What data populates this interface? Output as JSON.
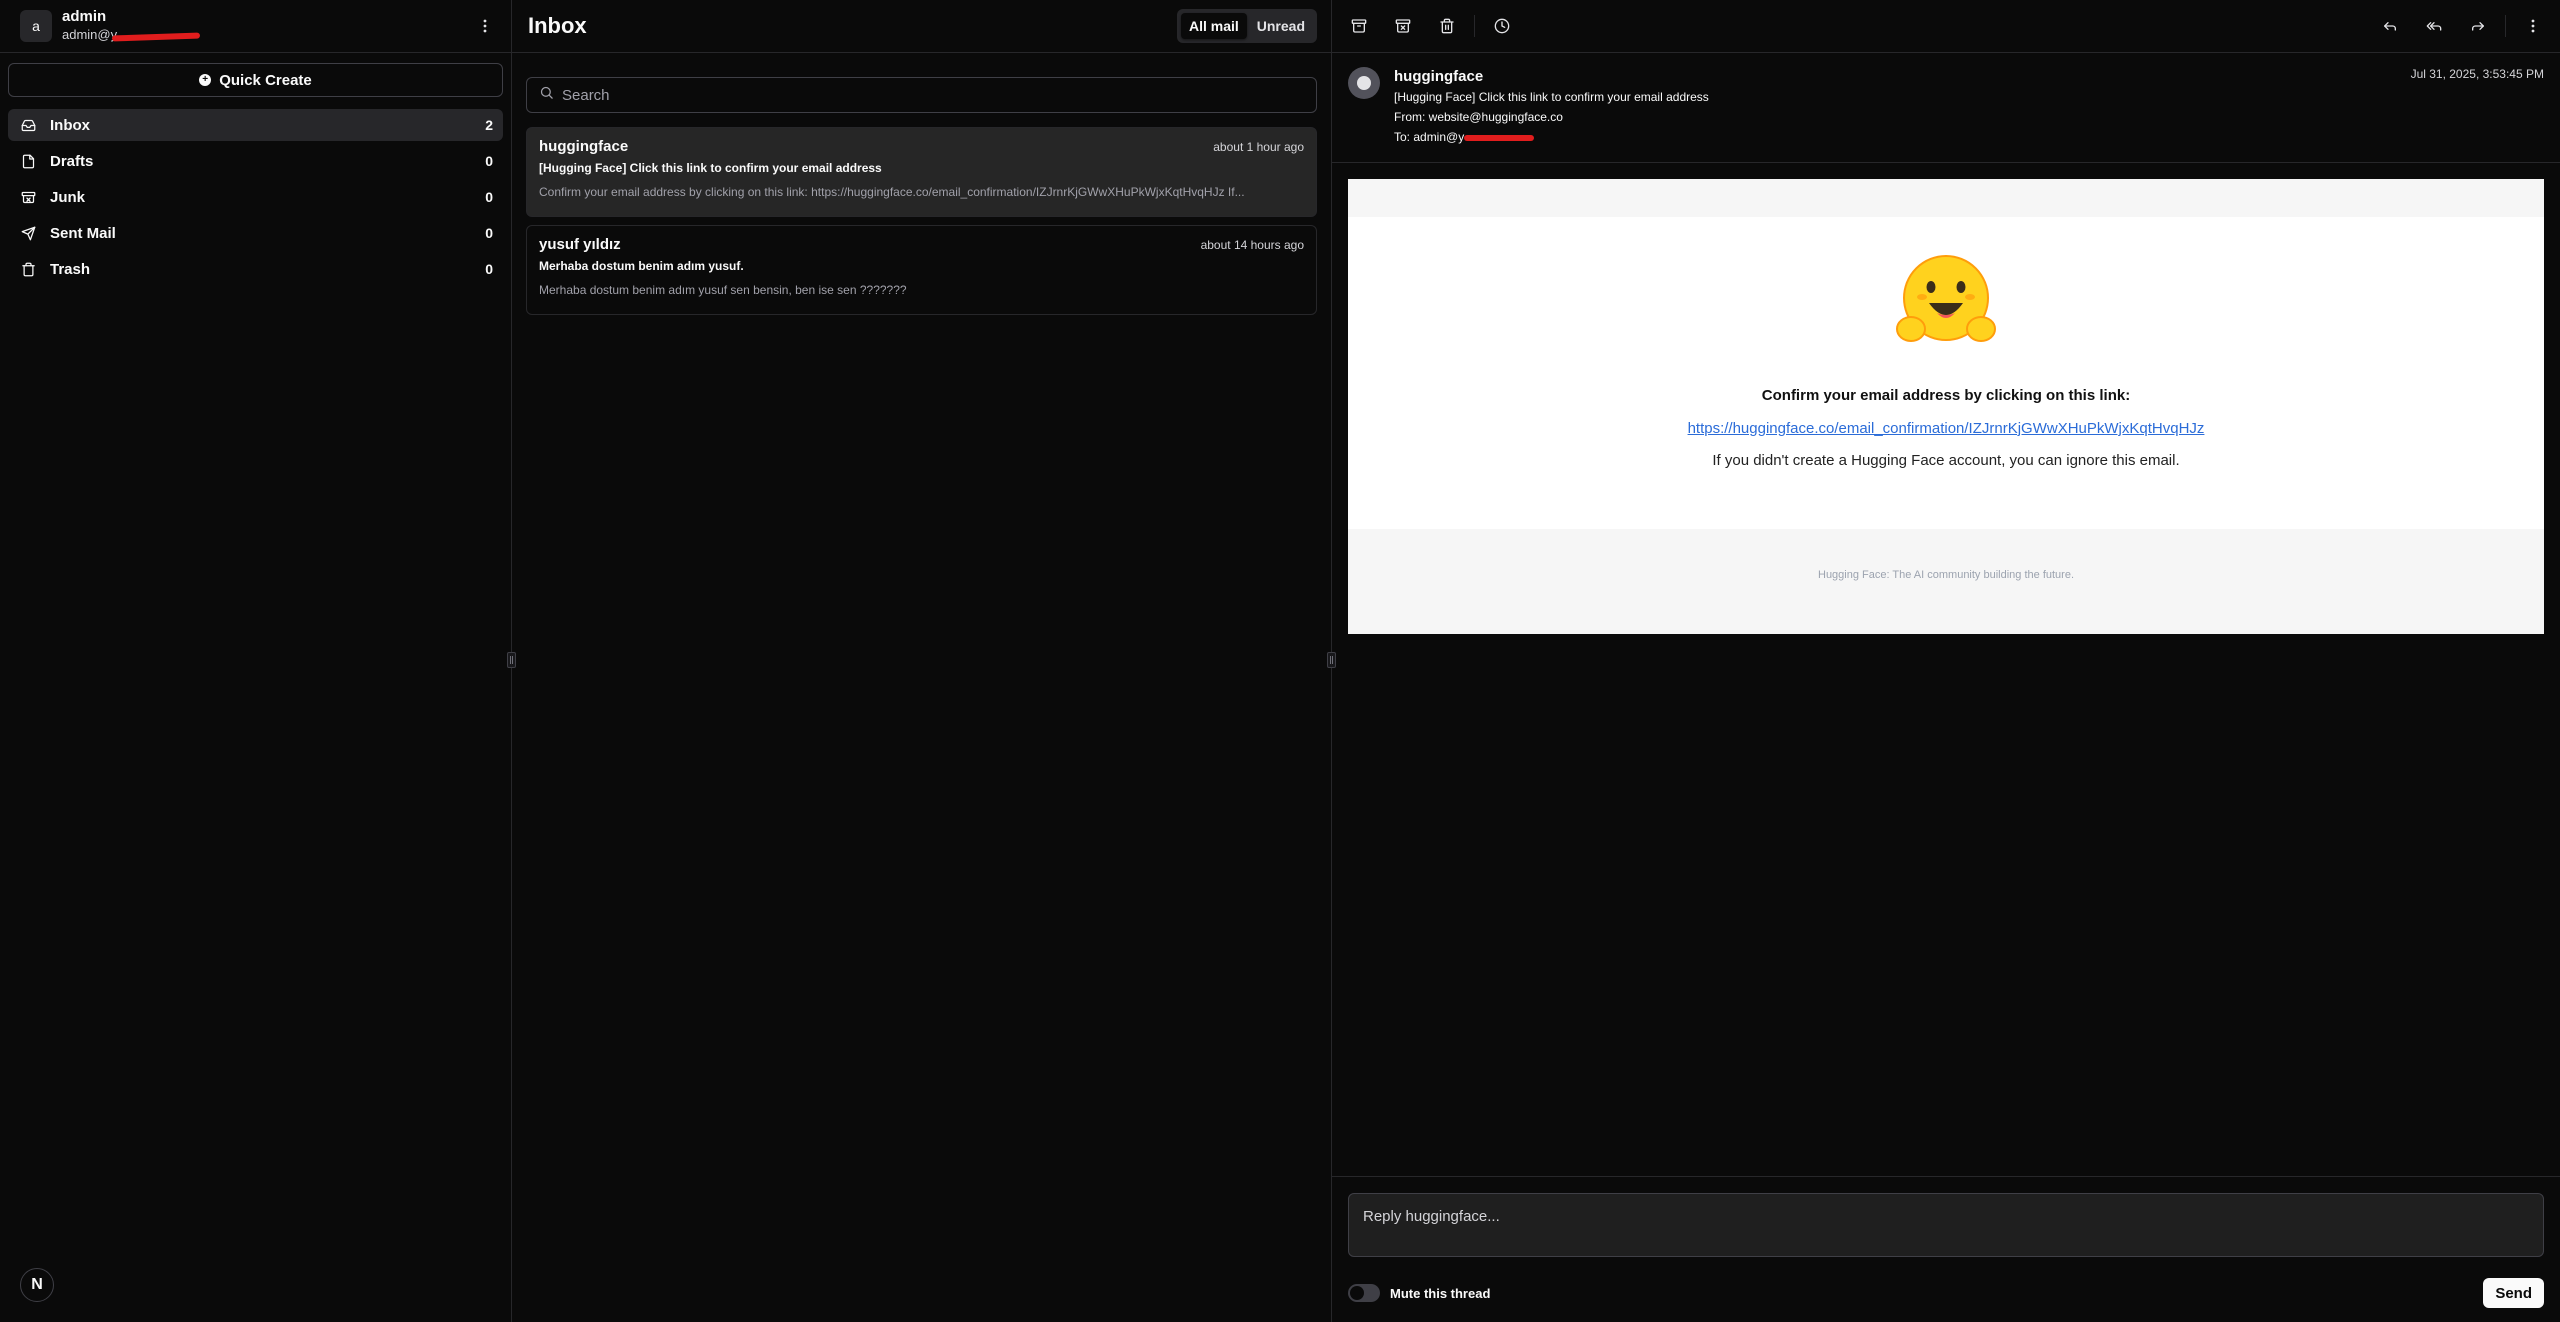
{
  "account": {
    "initial": "a",
    "name": "admin",
    "email": "admin@y"
  },
  "sidebar": {
    "quick_create": "Quick Create",
    "items": [
      {
        "label": "Inbox",
        "count": "2",
        "icon": "inbox-icon"
      },
      {
        "label": "Drafts",
        "count": "0",
        "icon": "file-icon"
      },
      {
        "label": "Junk",
        "count": "0",
        "icon": "archive-x-icon"
      },
      {
        "label": "Sent Mail",
        "count": "0",
        "icon": "send-icon"
      },
      {
        "label": "Trash",
        "count": "0",
        "icon": "trash-icon"
      }
    ],
    "logo": "N"
  },
  "list": {
    "title": "Inbox",
    "filters": [
      "All mail",
      "Unread"
    ],
    "search_placeholder": "Search",
    "mails": [
      {
        "from": "huggingface",
        "time": "about 1 hour ago",
        "subject": "[Hugging Face] Click this link to confirm your email address",
        "preview": "Confirm your email address by clicking on this link: https://huggingface.co/email_confirmation/IZJrnrKjGWwXHuPkWjxKqtHvqHJz If..."
      },
      {
        "from": "yusuf yıldız",
        "time": "about 14 hours ago",
        "subject": "Merhaba dostum benim adım yusuf.",
        "preview": "Merhaba dostum benim adım yusuf sen bensin, ben ise sen ???????"
      }
    ]
  },
  "detail": {
    "from_name": "huggingface",
    "subject": "[Hugging Face] Click this link to confirm your email address",
    "from_line": "From: website@huggingface.co",
    "to_line": "To: admin@y",
    "date": "Jul 31, 2025, 3:53:45 PM",
    "email": {
      "heading": "Confirm your email address by clicking on this link:",
      "link": "https://huggingface.co/email_confirmation/IZJrnrKjGWwXHuPkWjxKqtHvqHJz",
      "note": "If you didn't create a Hugging Face account, you can ignore this email.",
      "footer": "Hugging Face: The AI community building the future."
    },
    "reply_placeholder": "Reply huggingface...",
    "mute_label": "Mute this thread",
    "send_label": "Send"
  },
  "colors": {
    "background": "#0a0a0a",
    "border": "#27272a",
    "link": "#2b6cd8",
    "redaction": "#e11d1d"
  }
}
